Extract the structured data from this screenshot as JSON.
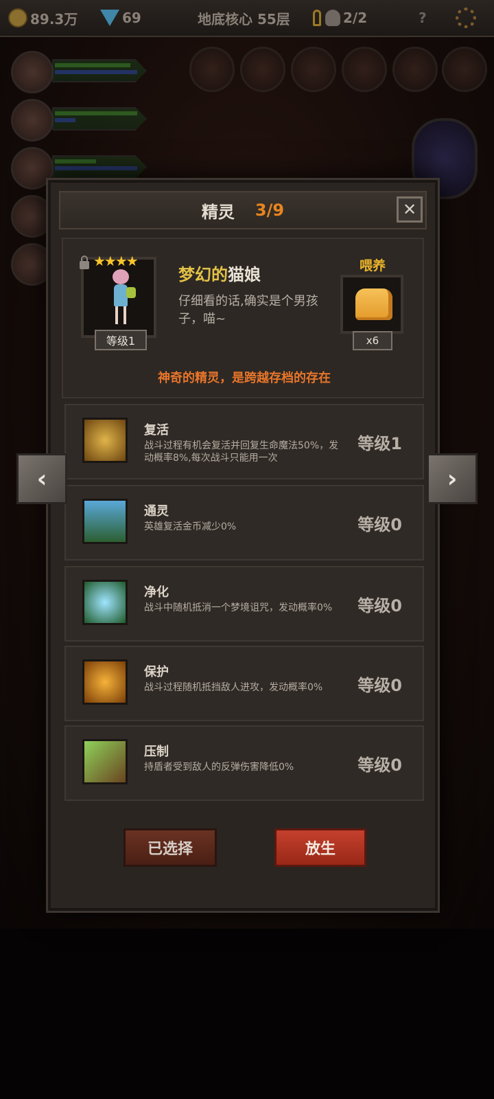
{
  "topbar": {
    "coins": "89.3万",
    "gems": "69",
    "location": "地底核心 55层",
    "keys_icon": "key-icon",
    "souls": "2/2",
    "help": "?",
    "settings_icon": "gear-icon"
  },
  "modal": {
    "title": "精灵",
    "count": "3/9",
    "close": "✕"
  },
  "pet": {
    "stars": "★★★★",
    "level": "等级1",
    "name_part1": "梦幻的",
    "name_part2": "猫娘",
    "description": "仔细看的话,确实是个男孩子，喵~",
    "feed_label": "喂养",
    "food_count": "x6",
    "tagline": "神奇的精灵，是跨越存档的存在"
  },
  "skills": [
    {
      "name": "复活",
      "desc": "战斗过程有机会复活并回复生命魔法50%，发动概率8%,每次战斗只能用一次",
      "level": "等级1",
      "icon": "revive-icon",
      "color": "#9b6d1e"
    },
    {
      "name": "通灵",
      "desc": "英雄复活金币减少0%",
      "level": "等级0",
      "icon": "tombstone-icon",
      "color": "#3a7cae"
    },
    {
      "name": "净化",
      "desc": "战斗中随机抵消一个梦境诅咒，发动概率0%",
      "level": "等级0",
      "icon": "flower-icon",
      "color": "#2e6fa0"
    },
    {
      "name": "保护",
      "desc": "战斗过程随机抵挡敌人进攻，发动概率0%",
      "level": "等级0",
      "icon": "shield-fairy-icon",
      "color": "#b86e14"
    },
    {
      "name": "压制",
      "desc": "持盾者受到敌人的反弹伤害降低0%",
      "level": "等级0",
      "icon": "claw-icon",
      "color": "#4f8f2a"
    }
  ],
  "buttons": {
    "selected": "已选择",
    "release": "放生"
  },
  "nav": {
    "prev": "‹",
    "next": "›"
  }
}
